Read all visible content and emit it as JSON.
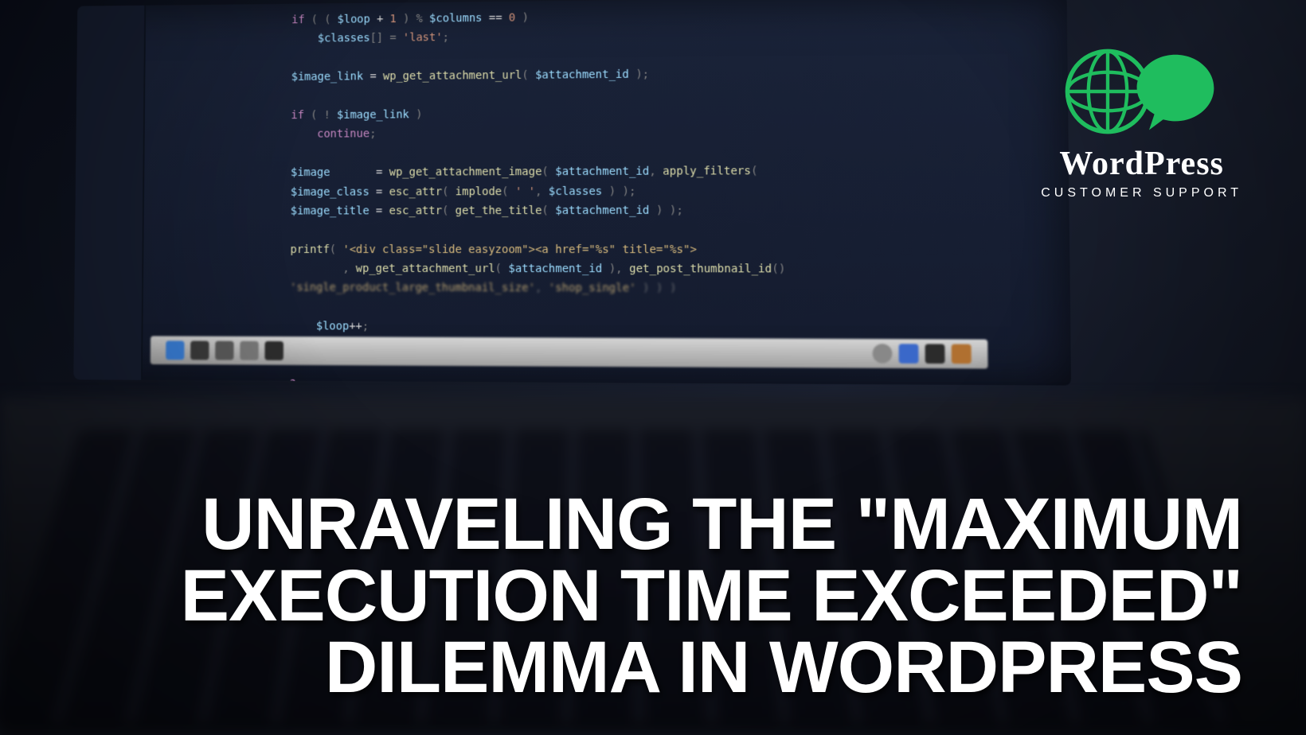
{
  "logo": {
    "title": "WordPress",
    "subtitle": "CUSTOMER SUPPORT",
    "globe_icon": "globe-icon",
    "speech_icon": "speech-bubble-icon"
  },
  "headline": {
    "text": "UNRAVELING THE \"MAXIMUM EXECUTION TIME EXCEEDED\" DILEMMA IN WORDPRESS"
  },
  "code": {
    "lines": [
      "if ( ( $loop + 1 ) % $columns == 0 )",
      "    $classes[] = 'last';",
      "",
      "$image_link = wp_get_attachment_url( $attachment_id );",
      "",
      "if ( ! $image_link )",
      "    continue;",
      "",
      "$image       = wp_get_attachment_image( $attachment_id, apply_filters(",
      "$image_class = esc_attr( implode( ' ', $classes ) );",
      "$image_title = esc_attr( get_the_title( $attachment_id ) );",
      "",
      "printf( '<div class=\"slide easyzoom\"><a href=\"%s\" title=\"%s\">",
      "        , wp_get_attachment_url( $attachment_id ), get_post_thumbnail_id()",
      "'single_product_large_thumbnail_size', 'shop_single' ) ) )",
      "",
      "$loop++;",
      "}",
      "",
      "?>"
    ]
  },
  "colors": {
    "accent_green": "#1fbd5e",
    "background_dark": "#0a0e1a",
    "text_white": "#ffffff"
  }
}
